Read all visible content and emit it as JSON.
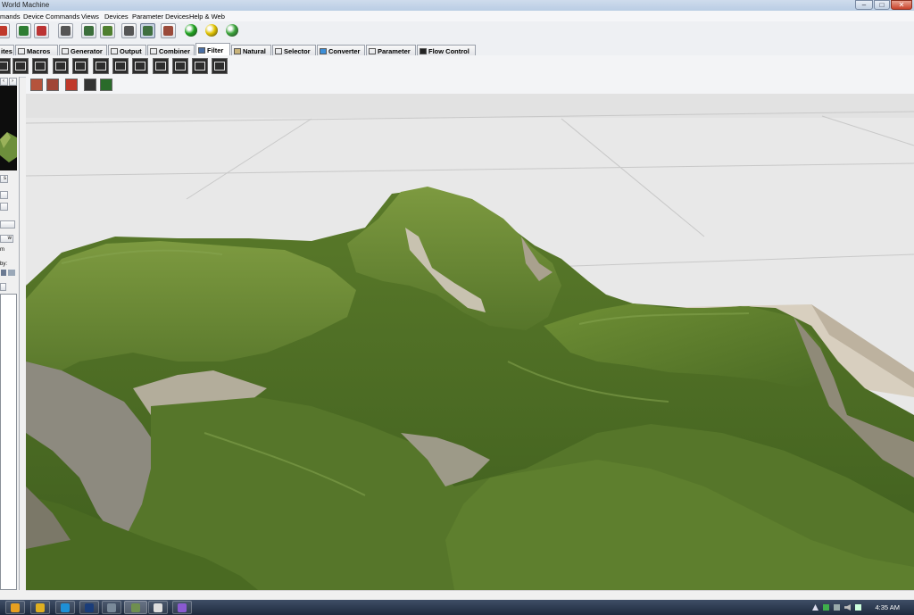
{
  "window": {
    "title": "World Machine",
    "minimize": "–",
    "maximize": "□",
    "close": "✕"
  },
  "menu": [
    "mands",
    "Device Commands",
    "Views",
    "Devices",
    "Parameter Devices",
    "Help & Web"
  ],
  "toolbar": {
    "buttons": [
      {
        "icon": "device-icon",
        "color": "#c0392b"
      },
      {
        "icon": "terrain-chart-icon",
        "color": "#2e7d32"
      },
      {
        "icon": "document-icon",
        "color": "#b33"
      },
      {
        "icon": "dice-icon",
        "color": "#555"
      },
      {
        "icon": "device-view-icon",
        "color": "#3b6e3b"
      },
      {
        "icon": "layout-view-icon",
        "color": "#4f7f2f"
      },
      {
        "icon": "explorer-view-icon",
        "color": "#555"
      },
      {
        "icon": "3d-preview-icon",
        "color": "#3f6f3f"
      },
      {
        "icon": "texture-icon",
        "color": "#9a4a3a"
      }
    ],
    "build_buttons": [
      {
        "icon": "build-green-ball-icon",
        "color": "#1fa31f"
      },
      {
        "icon": "build-yellow-ball-icon",
        "color": "#e2c400"
      },
      {
        "icon": "build-globe-ball-icon",
        "color": "#3aa33a"
      }
    ]
  },
  "tabs": [
    {
      "label": "ites",
      "icon": "favorites-icon"
    },
    {
      "label": "Macros",
      "icon": "macros-icon"
    },
    {
      "label": "Generator",
      "icon": "generator-icon"
    },
    {
      "label": "Output",
      "icon": "output-icon"
    },
    {
      "label": "Combiner",
      "icon": "combiner-icon"
    },
    {
      "label": "Filter",
      "icon": "filter-icon",
      "active": true
    },
    {
      "label": "Natural",
      "icon": "natural-icon"
    },
    {
      "label": "Selector",
      "icon": "selector-icon"
    },
    {
      "label": "Converter",
      "icon": "converter-icon"
    },
    {
      "label": "Parameter",
      "icon": "parameter-icon"
    },
    {
      "label": "Flow Control",
      "icon": "flow-control-icon"
    }
  ],
  "palette": [
    "clamp-filter-icon",
    "curve-filter-icon",
    "sawtooth-filter-icon",
    "terrace-filter-icon",
    "noise-filter-icon",
    "blur-filter-icon",
    "displace-filter-icon",
    "histogram-filter-icon",
    "transform-filter-icon",
    "expand-filter-icon",
    "threshold-filter-icon",
    "slope-filter-icon"
  ],
  "viewport_tools": [
    {
      "icon": "render-icon",
      "color": "#b5533c"
    },
    {
      "icon": "render-view-icon",
      "color": "#a04536"
    },
    {
      "icon": "snapshot-icon",
      "color": "#c0392b"
    },
    {
      "icon": "camera-icon",
      "color": "#333"
    },
    {
      "icon": "line-tool-icon",
      "color": "#2a6b2a"
    }
  ],
  "left_panel": {
    "nav_prev": "‹",
    "nav_next": "›",
    "btn1": "s",
    "btn2": "w",
    "label_m": "m",
    "label_by": "by:"
  },
  "taskbar": {
    "apps": [
      {
        "icon": "media-player-icon",
        "color": "#e8a020"
      },
      {
        "icon": "chrome-icon",
        "color": "#e0b020"
      },
      {
        "icon": "skype-icon",
        "color": "#1e90d6"
      },
      {
        "icon": "photoshop-icon",
        "color": "#1a3d7a"
      },
      {
        "icon": "app-icon",
        "color": "#7a8a99"
      },
      {
        "icon": "world-machine-icon",
        "color": "#6f8f4f"
      },
      {
        "icon": "unity-icon",
        "color": "#ddd"
      },
      {
        "icon": "aftereffects-icon",
        "color": "#8a5ad0"
      }
    ],
    "clock": "4:35 AM"
  }
}
